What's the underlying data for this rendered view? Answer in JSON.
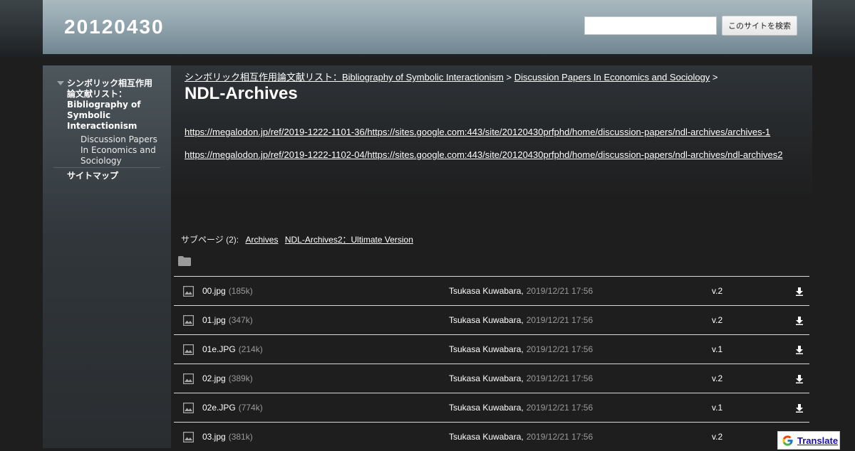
{
  "header": {
    "site_title": "20120430",
    "search_placeholder": "",
    "search_button": "このサイトを検索"
  },
  "sidebar": {
    "main_item": "シンボリック相互作用論文献リスト：Bibliography of Symbolic Interactionism",
    "sub_item": "Discussion Papers In Economics and Sociology",
    "sitemap": "サイトマップ"
  },
  "breadcrumb": {
    "crumb1": "シンボリック相互作用論文献リスト：Bibliography of Symbolic Interactionism",
    "sep1": " > ",
    "crumb2": "Discussion Papers In Economics and Sociology",
    "sep2": " >"
  },
  "page": {
    "title": "NDL-Archives",
    "links": [
      "https://megalodon.jp/ref/2019-1222-1101-36/https://sites.google.com:443/site/20120430prfphd/home/discussion-papers/ndl-archives/archives-1",
      "https://megalodon.jp/ref/2019-1222-1102-04/https://sites.google.com:443/site/20120430prfphd/home/discussion-papers/ndl-archives/ndl-archives2"
    ]
  },
  "subpages": {
    "label": "サブページ (2):",
    "items": [
      "Archives",
      "NDL-Archives2：Ultimate Version"
    ]
  },
  "files": [
    {
      "name": "00.jpg",
      "size": "(185k)",
      "author": "Tsukasa Kuwabara,",
      "date": "2019/12/21 17:56",
      "version": "v.2"
    },
    {
      "name": "01.jpg",
      "size": "(347k)",
      "author": "Tsukasa Kuwabara,",
      "date": "2019/12/21 17:56",
      "version": "v.2"
    },
    {
      "name": "01e.JPG",
      "size": "(214k)",
      "author": "Tsukasa Kuwabara,",
      "date": "2019/12/21 17:56",
      "version": "v.1"
    },
    {
      "name": "02.jpg",
      "size": "(389k)",
      "author": "Tsukasa Kuwabara,",
      "date": "2019/12/21 17:56",
      "version": "v.2"
    },
    {
      "name": "02e.JPG",
      "size": "(774k)",
      "author": "Tsukasa Kuwabara,",
      "date": "2019/12/21 17:56",
      "version": "v.1"
    },
    {
      "name": "03.jpg",
      "size": "(381k)",
      "author": "Tsukasa Kuwabara,",
      "date": "2019/12/21 17:56",
      "version": "v.2"
    }
  ],
  "icons": {
    "folder": "folder-icon",
    "file": "image-icon",
    "download": "download-arrow-icon",
    "translate": "google-g-icon"
  },
  "translate": {
    "label": "Translate"
  }
}
